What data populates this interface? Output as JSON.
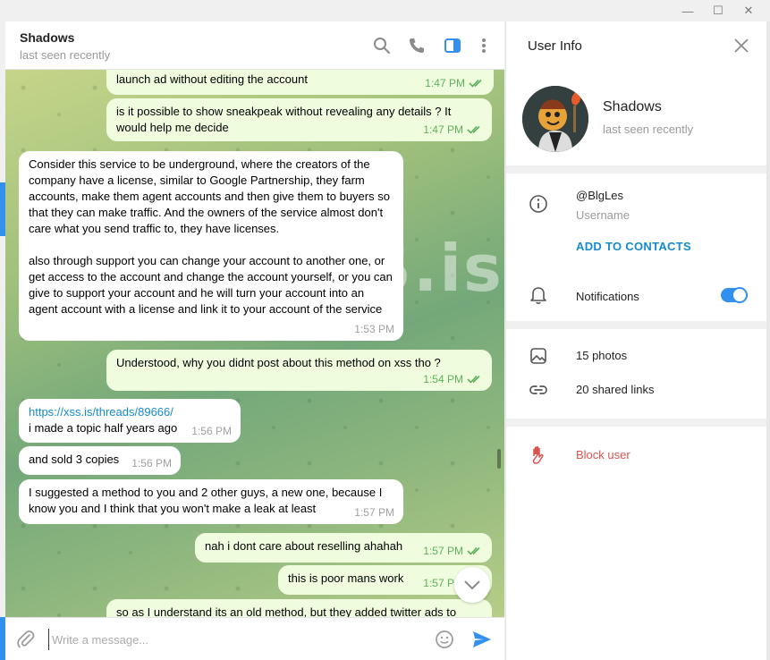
{
  "window": {
    "minimize": "—",
    "maximize": "☐",
    "close": "✕"
  },
  "chat": {
    "title": "Shadows",
    "status": "last seen recently",
    "watermark": "XSS.is",
    "messages": [
      {
        "dir": "out",
        "text": "launch ad without editing the account",
        "time": "1:47 PM",
        "read": true
      },
      {
        "dir": "out",
        "text": "is it possible to show sneakpeak without revealing any details ? It would help me decide",
        "time": "1:47 PM",
        "read": true
      },
      {
        "dir": "in",
        "text": "Consider this service to be underground, where the creators of the company have a license, similar to Google Partnership, they farm accounts, make them agent accounts and then give them to buyers so that they can make traffic. And the owners of the service almost don't care what you send traffic to, they have licenses.",
        "text2": "also through support you can change your account to another one, or get access to the account and change the account yourself, or you can give to support your account and he will turn your account into an agent account with a license and link it to your account of the service",
        "time": "1:53 PM"
      },
      {
        "dir": "out",
        "text": "Understood, why you didnt post about this method on xss tho ?",
        "time": "1:54 PM",
        "read": true
      },
      {
        "dir": "in",
        "link": "https://xss.is/threads/89666/",
        "text": "i made a topic half years ago",
        "time": "1:56 PM"
      },
      {
        "dir": "in",
        "text": "and sold 3 copies",
        "time": "1:56 PM"
      },
      {
        "dir": "in",
        "text": "I suggested a method to you and 2 other guys, a new one, because I know you and I think that you won't make a leak at least",
        "time": "1:57 PM"
      },
      {
        "dir": "out",
        "text": "nah i dont care about reselling ahahah",
        "time": "1:57 PM",
        "read": true
      },
      {
        "dir": "out",
        "text": "this is poor mans work",
        "time": "1:57 PM",
        "read": true
      },
      {
        "dir": "out",
        "text": "so as I understand its an old method, but they added twitter ads to"
      }
    ]
  },
  "composer": {
    "placeholder": "Write a message..."
  },
  "info": {
    "title": "User Info",
    "name": "Shadows",
    "status": "last seen recently",
    "username": "@BlgLes",
    "username_label": "Username",
    "add_contact": "ADD TO CONTACTS",
    "notifications_label": "Notifications",
    "notifications_on": true,
    "photos": "15 photos",
    "links": "20 shared links",
    "block": "Block user"
  },
  "colors": {
    "accent": "#3390ec",
    "danger": "#d9534f",
    "outgoing": "#effdde",
    "check": "#5fb05c"
  }
}
